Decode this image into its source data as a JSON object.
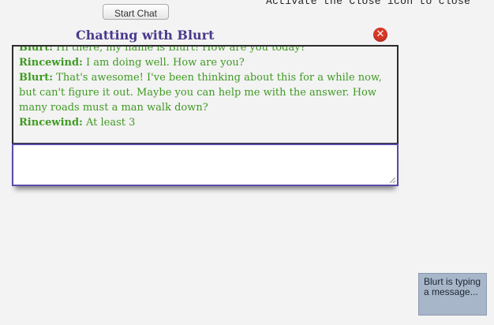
{
  "controls": {
    "start_chat_label": "Start Chat"
  },
  "instruction": "Activate the Close icon to close",
  "chat": {
    "title": "Chatting with Blurt",
    "close_icon": "close-icon",
    "messages": [
      {
        "speaker": "Blurt:",
        "text": "Hi there, my name is Blurt! How are you today?"
      },
      {
        "speaker": "Rincewind:",
        "text": "I am doing well. How are you?"
      },
      {
        "speaker": "Blurt:",
        "text": "That's awesome! I've been thinking about this for a while now, but can't figure it out. Maybe you can help me with the answer. How many roads must a man walk down?"
      },
      {
        "speaker": "Rincewind:",
        "text": "At least 3"
      }
    ],
    "input_value": ""
  },
  "status": {
    "typing_text": "Blurt is typing a message..."
  },
  "colors": {
    "title": "#4a3a8c",
    "message_text": "#3f9a22",
    "close_icon": "#d73828",
    "input_border": "#5a4aa8",
    "status_bg": "#a7b6c8"
  }
}
